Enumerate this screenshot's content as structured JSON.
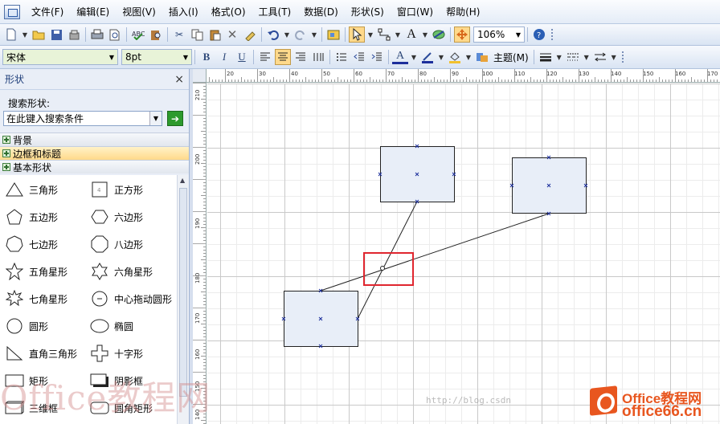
{
  "menu": {
    "items": [
      "文件(F)",
      "编辑(E)",
      "视图(V)",
      "插入(I)",
      "格式(O)",
      "工具(T)",
      "数据(D)",
      "形状(S)",
      "窗口(W)",
      "帮助(H)"
    ]
  },
  "toolbar": {
    "zoom": "106%",
    "font": "宋体",
    "font_size": "8pt",
    "bold": "B",
    "italic": "I",
    "underline": "U",
    "text_a": "A",
    "theme": "主题(M)"
  },
  "panel": {
    "title": "形状",
    "close": "×",
    "search_label": "搜索形状:",
    "search_placeholder": "在此键入搜索条件",
    "stencils": [
      "背景",
      "边框和标题",
      "基本形状"
    ],
    "shapes": [
      "三角形",
      "正方形",
      "五边形",
      "六边形",
      "七边形",
      "八边形",
      "五角星形",
      "六角星形",
      "七角星形",
      "中心拖动圆形",
      "圆形",
      "椭圆",
      "直角三角形",
      "十字形",
      "矩形",
      "阴影框",
      "三维框",
      "圆角矩形"
    ]
  },
  "rulers": {
    "h_labels": [
      "20",
      "30",
      "40",
      "50",
      "60",
      "70",
      "80",
      "90",
      "100",
      "110",
      "120",
      "130",
      "140",
      "150",
      "160",
      "170"
    ],
    "v_labels": [
      "210",
      "200",
      "190",
      "180",
      "170",
      "160",
      "150",
      "140"
    ]
  },
  "watermark": {
    "text": "Office教程网",
    "small": "http://blog.csdn",
    "logo_line1": "Office教程网",
    "logo_line2": "office66.cn"
  },
  "colors": {
    "shape_fill": "#e8eef8",
    "highlight": "#e0262f",
    "handle": "#1d2f9c"
  }
}
